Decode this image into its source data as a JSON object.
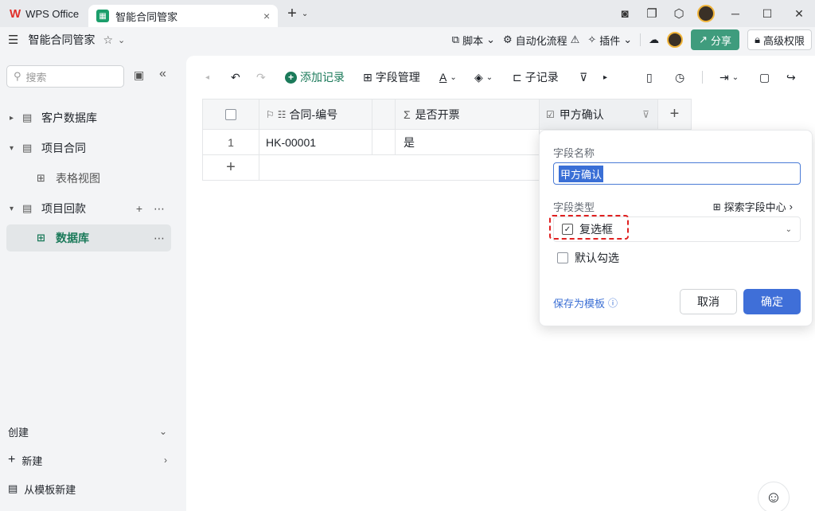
{
  "titlebar": {
    "wps_tab": "WPS Office",
    "doc_tab": "智能合同管家",
    "close_glyph": "×",
    "new_tab_glyph": "+"
  },
  "appbar": {
    "title": "智能合同管家",
    "script_label": "脚本",
    "automation_label": "自动化流程",
    "plugin_label": "插件",
    "share_label": "分享",
    "permission_label": "高级权限"
  },
  "sidebar": {
    "search_placeholder": "搜索",
    "items": [
      {
        "label": "客户数据库"
      },
      {
        "label": "项目合同"
      },
      {
        "label": "表格视图"
      },
      {
        "label": "项目回款"
      },
      {
        "label": "数据库"
      }
    ],
    "create_label": "创建",
    "new_label": "新建",
    "template_new_label": "从模板新建"
  },
  "toolbar": {
    "add_record": "添加记录",
    "field_manage": "字段管理",
    "sub_record": "子记录"
  },
  "table": {
    "columns": [
      "合同-编号",
      "是否开票",
      "甲方确认"
    ],
    "rows": [
      {
        "index": "1",
        "contract_no": "HK-00001",
        "invoiced": "是"
      }
    ]
  },
  "popup": {
    "field_name_label": "字段名称",
    "field_name_value": "甲方确认",
    "field_type_label": "字段类型",
    "explore_label": "探索字段中心",
    "field_type_value": "复选框",
    "default_check_label": "默认勾选",
    "save_template_label": "保存为模板",
    "cancel_label": "取消",
    "confirm_label": "确定"
  }
}
